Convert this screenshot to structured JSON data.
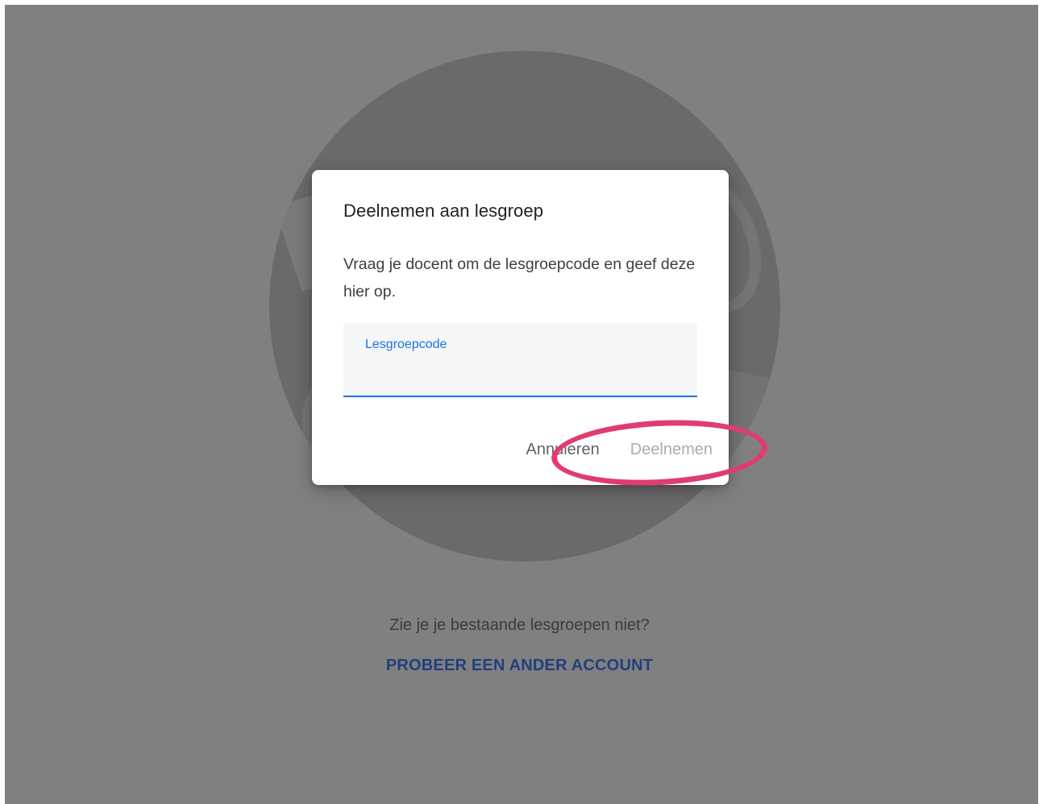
{
  "dialog": {
    "title": "Deelnemen aan lesgroep",
    "description": "Vraag je docent om de lesgroepcode en geef deze hier op.",
    "field_label": "Lesgroepcode",
    "field_value": "",
    "cancel_label": "Annuleren",
    "join_label": "Deelnemen"
  },
  "footer": {
    "text": "Zie je je bestaande lesgroepen niet?",
    "link_label": "PROBEER EEN ANDER ACCOUNT"
  },
  "colors": {
    "overlay": "#808080",
    "accent": "#1a73e8",
    "highlight_ring": "#e03c6e",
    "link": "#20407e"
  }
}
